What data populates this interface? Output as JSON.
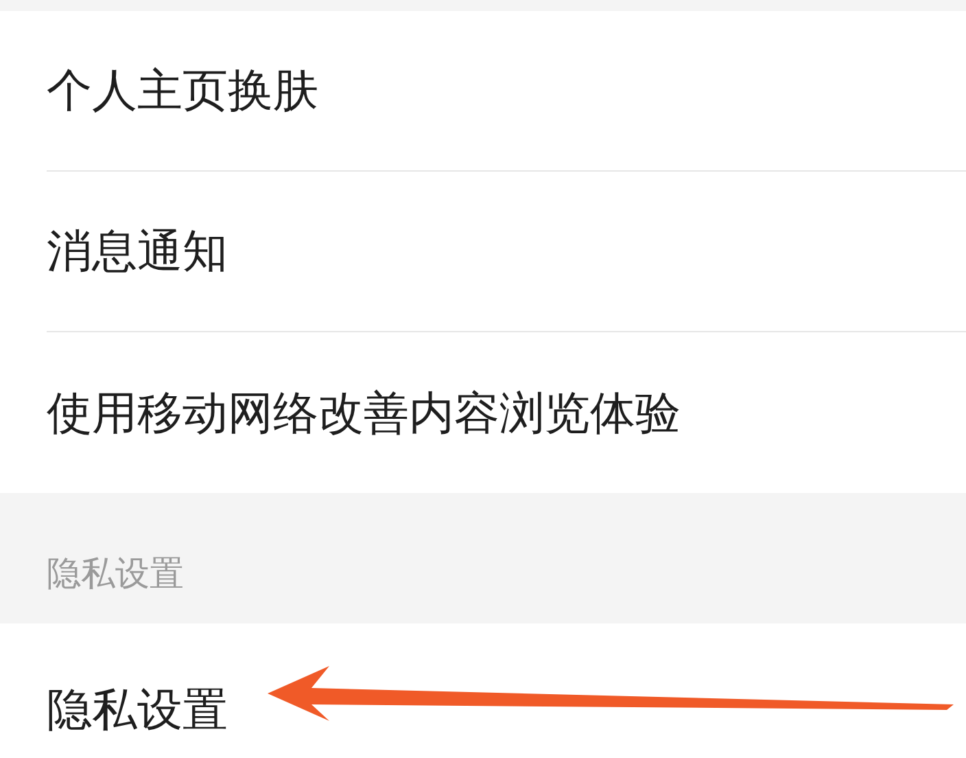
{
  "settings_items": [
    {
      "label": "个人主页换肤"
    },
    {
      "label": "消息通知"
    },
    {
      "label": "使用移动网络改善内容浏览体验"
    }
  ],
  "privacy_section": {
    "header": "隐私设置",
    "items": [
      {
        "label": "隐私设置"
      }
    ]
  }
}
